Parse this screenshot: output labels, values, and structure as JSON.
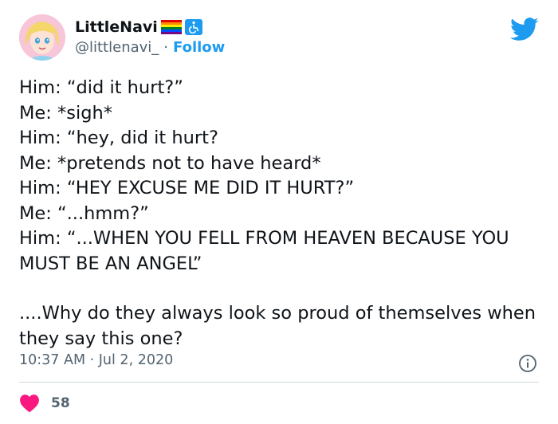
{
  "author": {
    "display_name": "LittleNavi",
    "handle": "@littlenavi_",
    "separator": "·",
    "follow_label": "Follow"
  },
  "tweet": {
    "lines": [
      "Him: “did it hurt?”",
      "Me: *sigh*",
      "Him: “hey, did it hurt?",
      "Me: *pretends not to have heard*",
      "Him: “HEY EXCUSE ME DID IT HURT?”",
      "Me: “...hmm?”",
      "Him: “...WHEN YOU FELL FROM HEAVEN BECAUSE YOU MUST BE AN ANGEL”"
    ],
    "closing": "....Why do they always look so proud of themselves when they say this one?"
  },
  "meta": {
    "timestamp": "10:37 AM · Jul 2, 2020"
  },
  "engagement": {
    "like_count": "58"
  },
  "icons": {
    "brand": "twitter-bird-icon",
    "info": "info-icon",
    "like": "heart-icon",
    "flag": "rainbow-flag-icon",
    "accessibility": "wheelchair-icon"
  },
  "colors": {
    "brand": "#1d9bf0",
    "text": "#0f1419",
    "muted": "#536471",
    "heart": "#f91880",
    "divider": "#cfd9de"
  }
}
